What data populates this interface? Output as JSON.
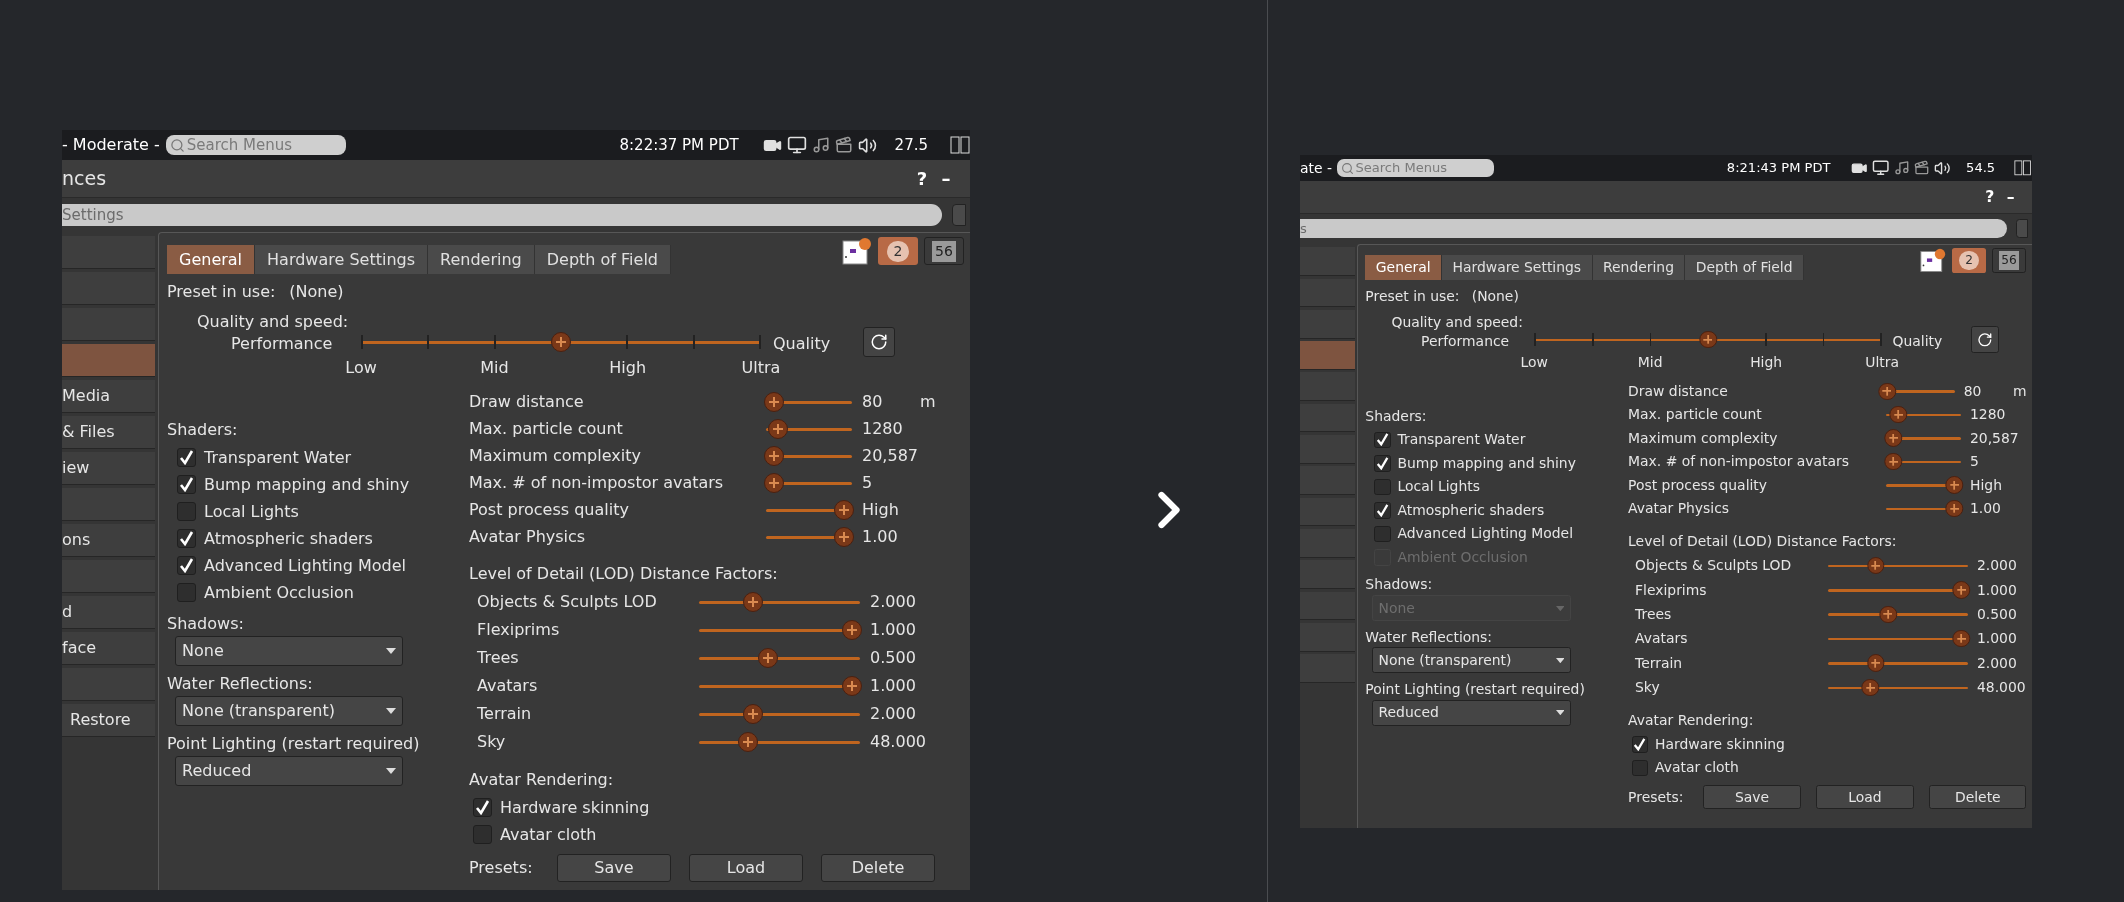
{
  "screenshots": [
    {
      "status_bar": {
        "maturity": "- Moderate -",
        "search_placeholder": "Search Menus",
        "time": "8:22:37 PM PDT",
        "fps": "27.5"
      },
      "window_title": "nces",
      "title_buttons": [
        "?",
        "–"
      ],
      "search_value": "Settings",
      "sidebar": [
        {
          "selected": false
        },
        {
          "selected": false
        },
        {
          "selected": false
        },
        {
          "selected": true
        },
        {
          "label": "Media",
          "selected": false
        },
        {
          "label": "& Files",
          "selected": false
        },
        {
          "label": "iew",
          "selected": false
        },
        {
          "selected": false
        },
        {
          "label": "ons",
          "selected": false
        },
        {
          "selected": false
        },
        {
          "label": "d",
          "selected": false
        },
        {
          "label": "face",
          "selected": false
        },
        {
          "selected": false
        },
        {
          "label": "Restore",
          "selected": false
        }
      ],
      "badges": [
        "2",
        "56"
      ],
      "tabs": [
        {
          "label": "General",
          "selected": true
        },
        {
          "label": "Hardware Settings",
          "selected": false
        },
        {
          "label": "Rendering",
          "selected": false
        },
        {
          "label": "Depth of Field",
          "selected": false
        }
      ],
      "preset": {
        "label": "Preset in use:",
        "value": "(None)"
      },
      "quality": {
        "label": "Quality and speed:",
        "left": "Performance",
        "right": "Quality",
        "level": 0.5,
        "ticks": [
          "Low",
          "Mid",
          "High",
          "Ultra"
        ]
      },
      "shaders": {
        "label": "Shaders:",
        "items": [
          {
            "label": "Transparent Water",
            "checked": true,
            "disabled": false
          },
          {
            "label": "Bump mapping and shiny",
            "checked": true,
            "disabled": false
          },
          {
            "label": "Local Lights",
            "checked": false,
            "disabled": false
          },
          {
            "label": "Atmospheric shaders",
            "checked": true,
            "disabled": false
          },
          {
            "label": "Advanced Lighting Model",
            "checked": true,
            "disabled": false
          },
          {
            "label": "Ambient Occlusion",
            "checked": false,
            "disabled": false
          }
        ]
      },
      "dropdowns": [
        {
          "label": "Shadows:",
          "value": "None",
          "disabled": false
        },
        {
          "label": "Water Reflections:",
          "value": "None (transparent)",
          "disabled": false
        },
        {
          "label": "Point Lighting (restart required)",
          "value": "Reduced",
          "disabled": false
        }
      ],
      "sliders": [
        {
          "label": "Draw distance",
          "level": 0.0,
          "reading": "80",
          "unit": "m"
        },
        {
          "label": "Max. particle count",
          "level": 0.05,
          "reading": "1280"
        },
        {
          "label": "Maximum complexity",
          "level": 0.0,
          "reading": "20,587"
        },
        {
          "label": "Max. # of non-impostor avatars",
          "level": 0.0,
          "reading": "5"
        },
        {
          "label": "Post process quality",
          "level": 1.0,
          "reading": "High"
        },
        {
          "label": "Avatar Physics",
          "level": 1.0,
          "reading": "1.00"
        }
      ],
      "lod": {
        "label": "Level of Detail (LOD) Distance Factors:",
        "sliders": [
          {
            "label": "Objects & Sculpts LOD",
            "level": 0.32,
            "reading": "2.000"
          },
          {
            "label": "Flexiprims",
            "level": 1.0,
            "reading": "1.000"
          },
          {
            "label": "Trees",
            "level": 0.42,
            "reading": "0.500"
          },
          {
            "label": "Avatars",
            "level": 1.0,
            "reading": "1.000"
          },
          {
            "label": "Terrain",
            "level": 0.32,
            "reading": "2.000"
          },
          {
            "label": "Sky",
            "level": 0.28,
            "reading": "48.000"
          }
        ]
      },
      "avatar_rendering": {
        "label": "Avatar Rendering:",
        "items": [
          {
            "label": "Hardware skinning",
            "checked": true,
            "disabled": false
          },
          {
            "label": "Avatar cloth",
            "checked": false,
            "disabled": false
          }
        ]
      },
      "presets": {
        "label": "Presets:",
        "buttons": [
          "Save",
          "Load",
          "Delete"
        ]
      }
    },
    {
      "status_bar": {
        "maturity": "ate -",
        "search_placeholder": "Search Menus",
        "time": "8:21:43 PM PDT",
        "fps": "54.5"
      },
      "title_buttons": [
        "?",
        "–"
      ],
      "search_value": "s",
      "sidebar": [
        {
          "selected": false
        },
        {
          "selected": false
        },
        {
          "selected": false
        },
        {
          "selected": true
        },
        {
          "selected": false
        },
        {
          "selected": false
        },
        {
          "selected": false
        },
        {
          "selected": false
        },
        {
          "selected": false
        },
        {
          "selected": false
        },
        {
          "selected": false
        },
        {
          "selected": false
        },
        {
          "selected": false
        },
        {
          "selected": false
        }
      ],
      "badges": [
        "2",
        "56"
      ],
      "tabs": [
        {
          "label": "General",
          "selected": true
        },
        {
          "label": "Hardware Settings",
          "selected": false
        },
        {
          "label": "Rendering",
          "selected": false
        },
        {
          "label": "Depth of Field",
          "selected": false
        }
      ],
      "preset": {
        "label": "Preset in use:",
        "value": "(None)"
      },
      "quality": {
        "label": "Quality and speed:",
        "left": "Performance",
        "right": "Quality",
        "level": 0.5,
        "ticks": [
          "Low",
          "Mid",
          "High",
          "Ultra"
        ]
      },
      "shaders": {
        "label": "Shaders:",
        "items": [
          {
            "label": "Transparent Water",
            "checked": true,
            "disabled": false
          },
          {
            "label": "Bump mapping and shiny",
            "checked": true,
            "disabled": false
          },
          {
            "label": "Local Lights",
            "checked": false,
            "disabled": false
          },
          {
            "label": "Atmospheric shaders",
            "checked": true,
            "disabled": false
          },
          {
            "label": "Advanced Lighting Model",
            "checked": false,
            "disabled": false
          },
          {
            "label": "Ambient Occlusion",
            "checked": false,
            "disabled": true
          }
        ]
      },
      "dropdowns": [
        {
          "label": "Shadows:",
          "value": "None",
          "disabled": true
        },
        {
          "label": "Water Reflections:",
          "value": "None (transparent)",
          "disabled": false
        },
        {
          "label": "Point Lighting (restart required)",
          "value": "Reduced",
          "disabled": false
        }
      ],
      "sliders": [
        {
          "label": "Draw distance",
          "level": 0.0,
          "reading": "80",
          "unit": "m"
        },
        {
          "label": "Max. particle count",
          "level": 0.08,
          "reading": "1280"
        },
        {
          "label": "Maximum complexity",
          "level": 0.0,
          "reading": "20,587"
        },
        {
          "label": "Max. # of non-impostor avatars",
          "level": 0.0,
          "reading": "5"
        },
        {
          "label": "Post process quality",
          "level": 1.0,
          "reading": "High"
        },
        {
          "label": "Avatar Physics",
          "level": 1.0,
          "reading": "1.00"
        }
      ],
      "lod": {
        "label": "Level of Detail (LOD) Distance Factors:",
        "sliders": [
          {
            "label": "Objects & Sculpts LOD",
            "level": 0.32,
            "reading": "2.000"
          },
          {
            "label": "Flexiprims",
            "level": 1.0,
            "reading": "1.000"
          },
          {
            "label": "Trees",
            "level": 0.42,
            "reading": "0.500"
          },
          {
            "label": "Avatars",
            "level": 1.0,
            "reading": "1.000"
          },
          {
            "label": "Terrain",
            "level": 0.32,
            "reading": "2.000"
          },
          {
            "label": "Sky",
            "level": 0.28,
            "reading": "48.000"
          }
        ]
      },
      "avatar_rendering": {
        "label": "Avatar Rendering:",
        "items": [
          {
            "label": "Hardware skinning",
            "checked": true,
            "disabled": false
          },
          {
            "label": "Avatar cloth",
            "checked": false,
            "disabled": false
          }
        ]
      },
      "presets": {
        "label": "Presets:",
        "buttons": [
          "Save",
          "Load",
          "Delete"
        ]
      }
    }
  ]
}
